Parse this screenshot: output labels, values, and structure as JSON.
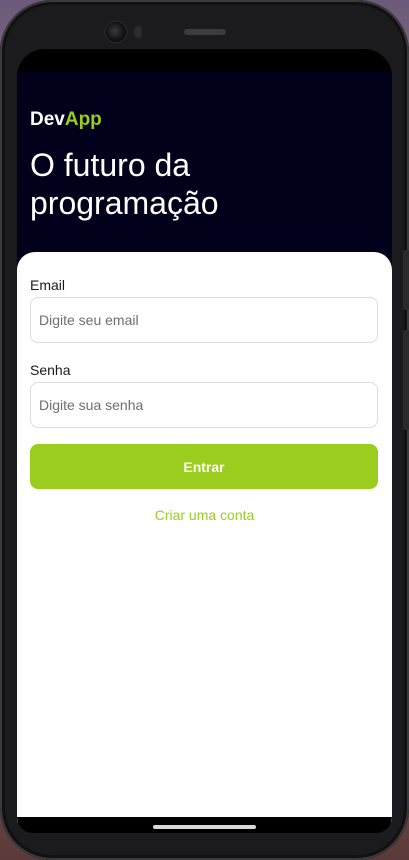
{
  "brand": {
    "prefix": "Dev",
    "accent": "App",
    "accent_color": "#9acd1e"
  },
  "hero": {
    "headline": "O futuro da programação",
    "background": "#02011c"
  },
  "form": {
    "email_label": "Email",
    "email_placeholder": "Digite seu email",
    "email_value": "",
    "password_label": "Senha",
    "password_placeholder": "Digite sua senha",
    "password_value": "",
    "submit_label": "Entrar",
    "create_account_label": "Criar uma conta"
  },
  "icons": [
    "camera-icon",
    "speaker-icon",
    "home-indicator-icon"
  ]
}
